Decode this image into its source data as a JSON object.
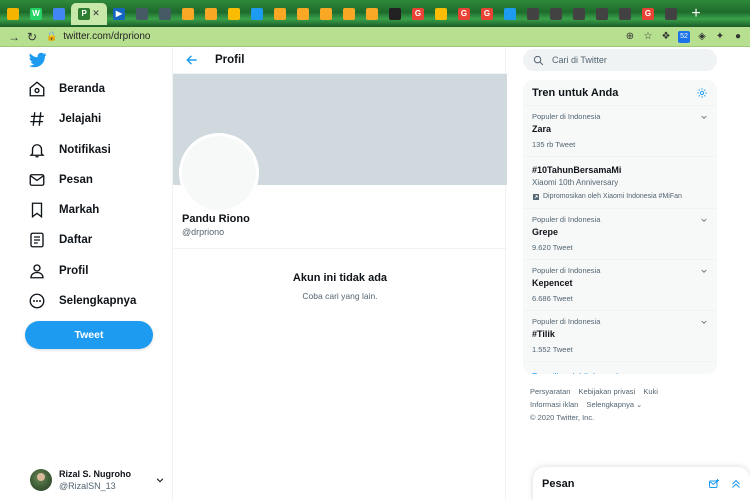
{
  "browser": {
    "tabs": [
      {
        "icon": "chart-favicon",
        "color": "#f4b400",
        "glyph": ""
      },
      {
        "icon": "whatsapp-favicon",
        "color": "#25d366",
        "glyph": "W"
      },
      {
        "icon": "blue-favicon",
        "color": "#4285f4",
        "glyph": ""
      },
      {
        "icon": "p-favicon",
        "color": "#2e7d32",
        "glyph": "P"
      },
      {
        "icon": "video-favicon",
        "color": "#1565c0",
        "glyph": "▶"
      },
      {
        "icon": "news-favicon",
        "color": "#455a64",
        "glyph": ""
      },
      {
        "icon": "news-favicon",
        "color": "#455a64",
        "glyph": ""
      },
      {
        "icon": "sheet-favicon",
        "color": "#f9a825",
        "glyph": ""
      },
      {
        "icon": "sheet-favicon",
        "color": "#f9a825",
        "glyph": ""
      },
      {
        "icon": "ads-favicon",
        "color": "#fbbc04",
        "glyph": ""
      },
      {
        "icon": "twitter-favicon",
        "color": "#1d9bf0",
        "glyph": ""
      },
      {
        "icon": "sheet-favicon",
        "color": "#f9a825",
        "glyph": ""
      },
      {
        "icon": "sheet-favicon",
        "color": "#f9a825",
        "glyph": ""
      },
      {
        "icon": "sheet-favicon",
        "color": "#f9a825",
        "glyph": ""
      },
      {
        "icon": "sheet-favicon",
        "color": "#f9a825",
        "glyph": ""
      },
      {
        "icon": "sheet-favicon",
        "color": "#f9a825",
        "glyph": ""
      },
      {
        "icon": "hd-favicon",
        "color": "#212121",
        "glyph": ""
      },
      {
        "icon": "google-favicon",
        "color": "#ea4335",
        "glyph": "G"
      },
      {
        "icon": "ads-favicon",
        "color": "#fbbc04",
        "glyph": ""
      },
      {
        "icon": "google-favicon",
        "color": "#ea4335",
        "glyph": "G"
      },
      {
        "icon": "google-favicon",
        "color": "#ea4335",
        "glyph": "G"
      },
      {
        "icon": "twitter-favicon",
        "color": "#1d9bf0",
        "glyph": ""
      },
      {
        "icon": "doc-favicon",
        "color": "#424242",
        "glyph": ""
      },
      {
        "icon": "doc-favicon",
        "color": "#424242",
        "glyph": ""
      },
      {
        "icon": "doc-favicon",
        "color": "#424242",
        "glyph": ""
      },
      {
        "icon": "doc-favicon",
        "color": "#424242",
        "glyph": ""
      },
      {
        "icon": "doc-favicon",
        "color": "#424242",
        "glyph": ""
      },
      {
        "icon": "google-favicon",
        "color": "#ea4335",
        "glyph": "G"
      },
      {
        "icon": "doc-favicon",
        "color": "#424242",
        "glyph": ""
      }
    ],
    "active_tab_index": 3,
    "active_tab_glyph": "P",
    "close_glyph": "✕",
    "new_tab_glyph": "+",
    "url": "twitter.com/drpriono",
    "extension_badge": "52"
  },
  "sidebar": {
    "items": [
      {
        "name": "home",
        "label": "Beranda"
      },
      {
        "name": "explore",
        "label": "Jelajahi"
      },
      {
        "name": "notifications",
        "label": "Notifikasi"
      },
      {
        "name": "messages",
        "label": "Pesan"
      },
      {
        "name": "bookmarks",
        "label": "Markah"
      },
      {
        "name": "lists",
        "label": "Daftar"
      },
      {
        "name": "profile",
        "label": "Profil"
      },
      {
        "name": "more",
        "label": "Selengkapnya"
      }
    ],
    "tweet_label": "Tweet",
    "account": {
      "name": "Rizal S. Nugroho",
      "handle": "@RizalSN_13"
    }
  },
  "main": {
    "title": "Profil",
    "display_name": "Pandu Riono",
    "handle": "@drpriono",
    "not_available_title": "Akun ini tidak ada",
    "not_available_sub": "Coba cari yang lain."
  },
  "right": {
    "search_placeholder": "Cari di Twitter",
    "trends_title": "Tren untuk Anda",
    "trends": [
      {
        "context": "Populer di Indonesia",
        "name": "Zara",
        "count": "135 rb Tweet"
      },
      {
        "name": "#10TahunBersamaMi",
        "sub": "Xiaomi 10th Anniversary",
        "promo": "Dipromosikan oleh Xiaomi Indonesia #MiFan"
      },
      {
        "context": "Populer di Indonesia",
        "name": "Grepe",
        "count": "9.620 Tweet"
      },
      {
        "context": "Populer di Indonesia",
        "name": "Kepencet",
        "count": "6.686 Tweet"
      },
      {
        "context": "Populer di Indonesia",
        "name": "#Tilik",
        "count": "1.552 Tweet"
      }
    ],
    "show_more": "Tampilkan lebih banyak",
    "footer": {
      "links": [
        "Persyaratan",
        "Kebijakan privasi",
        "Kuki",
        "Informasi iklan",
        "Selengkapnya"
      ],
      "copyright": "© 2020 Twitter, Inc."
    },
    "messages_title": "Pesan"
  },
  "colors": {
    "accent": "#1d9bf0",
    "banner": "#cfd9de",
    "addressbar": "#b7df90"
  }
}
